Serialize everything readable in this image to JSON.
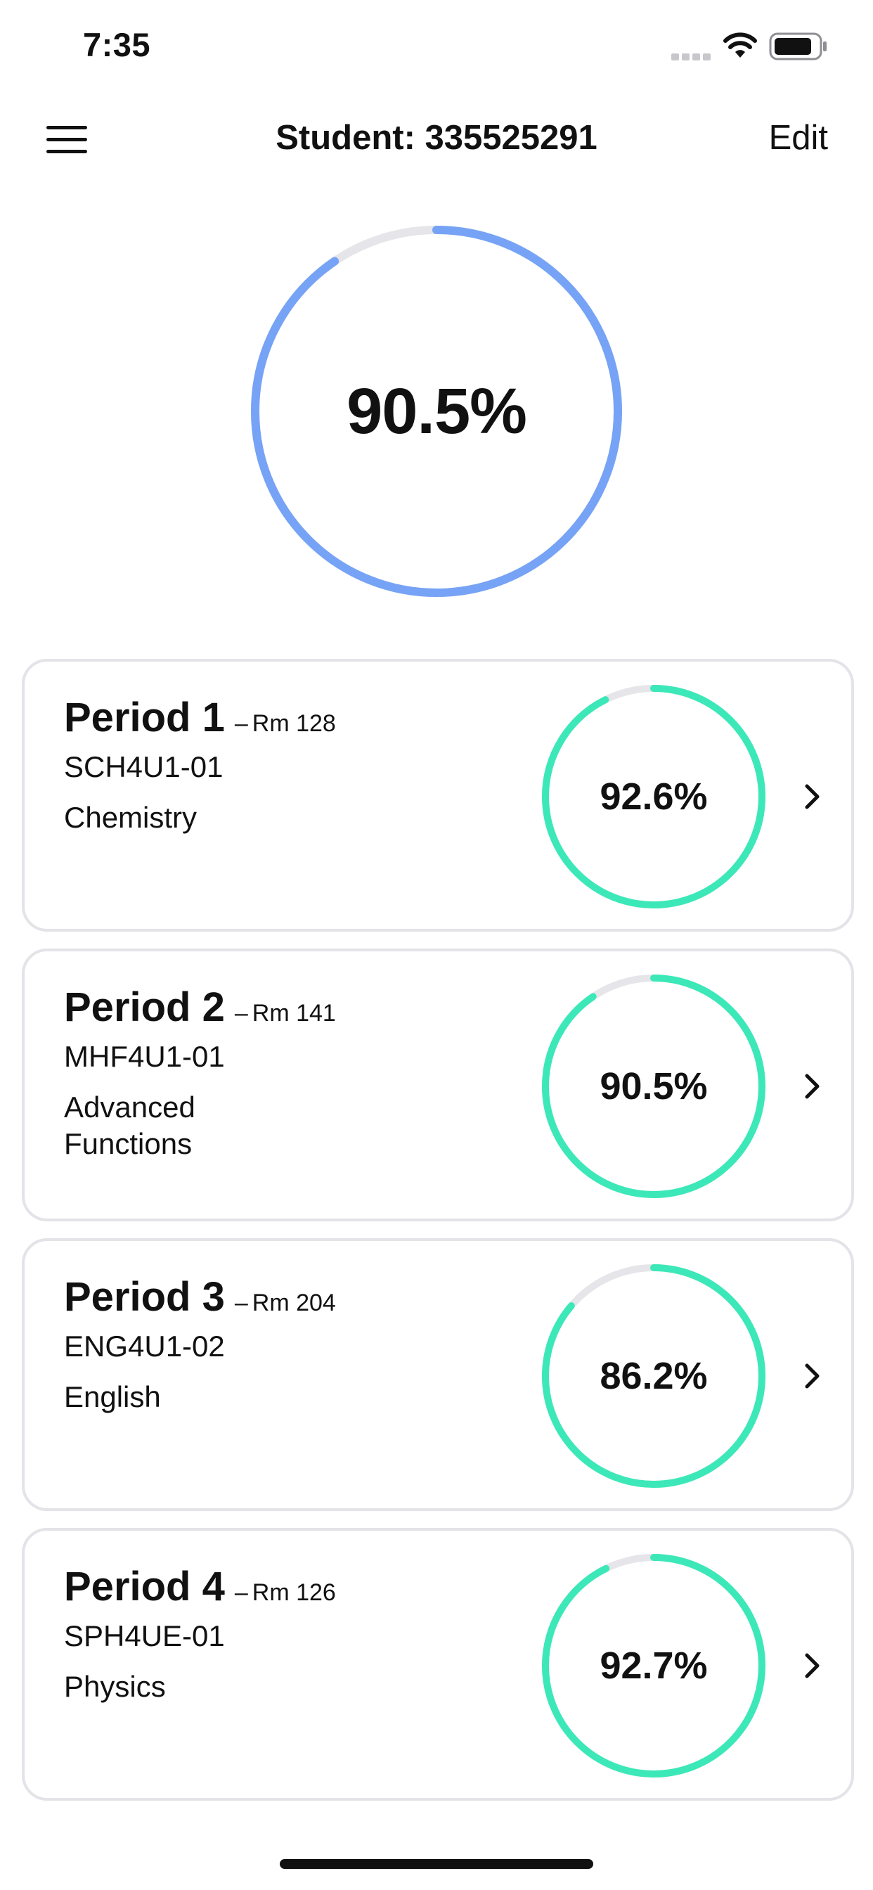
{
  "status_bar": {
    "time": "7:35"
  },
  "nav": {
    "title": "Student: 335525291",
    "edit_label": "Edit",
    "menu_icon": "hamburger-menu-icon"
  },
  "overall": {
    "grade_text": "90.5%",
    "progress_percent": 90.5
  },
  "colors": {
    "overall_ring": "#76a3f5",
    "course_ring": "#3ce8b8",
    "ring_track": "#e5e5ea",
    "card_border": "#e3e3e8"
  },
  "courses": [
    {
      "period": "Period 1",
      "room_sep": "–",
      "room": "Rm 128",
      "code": "SCH4U1-01",
      "name": "Chemistry",
      "grade_text": "92.6%",
      "progress_percent": 92.6
    },
    {
      "period": "Period 2",
      "room_sep": "–",
      "room": "Rm 141",
      "code": "MHF4U1-01",
      "name": "Advanced Functions",
      "grade_text": "90.5%",
      "progress_percent": 90.5
    },
    {
      "period": "Period 3",
      "room_sep": "–",
      "room": "Rm 204",
      "code": "ENG4U1-02",
      "name": "English",
      "grade_text": "86.2%",
      "progress_percent": 86.2
    },
    {
      "period": "Period 4",
      "room_sep": "–",
      "room": "Rm 126",
      "code": "SPH4UE-01",
      "name": "Physics",
      "grade_text": "92.7%",
      "progress_percent": 92.7
    }
  ]
}
